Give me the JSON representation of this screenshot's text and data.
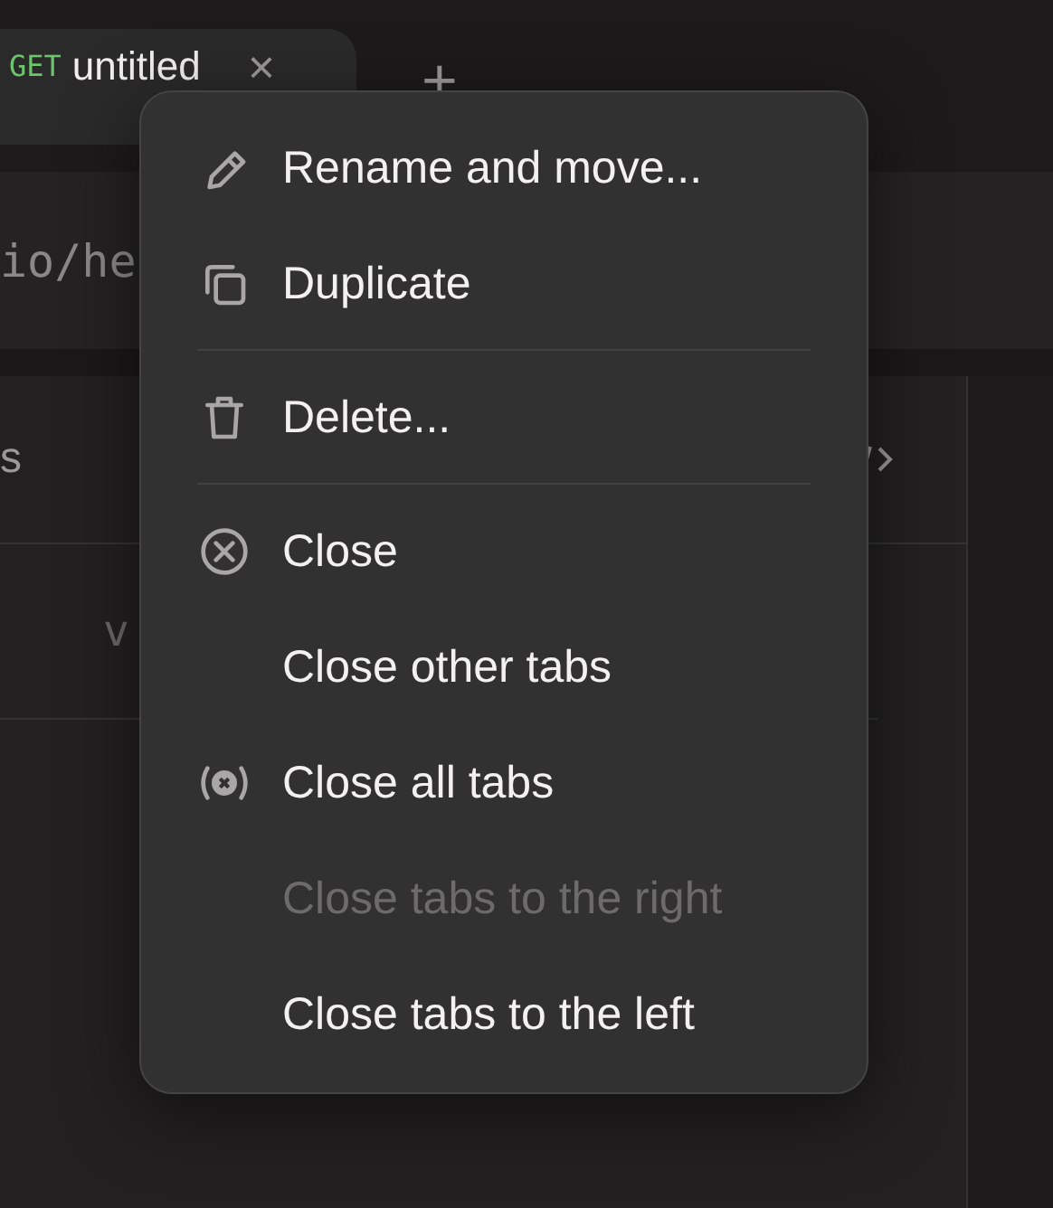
{
  "tab": {
    "method": "GET",
    "title": "untitled",
    "close": "×"
  },
  "new_tab": "+",
  "url_fragment": "io/he",
  "panel_tab_fragment": "s",
  "row_placeholder_fragment": "v",
  "context_menu": {
    "sections": [
      [
        {
          "label": "Rename and move...",
          "disabled": false
        },
        {
          "label": "Duplicate",
          "disabled": false
        }
      ],
      [
        {
          "label": "Delete...",
          "disabled": false
        }
      ],
      [
        {
          "label": "Close",
          "disabled": false
        },
        {
          "label": "Close other tabs",
          "disabled": false
        },
        {
          "label": "Close all tabs",
          "disabled": false
        },
        {
          "label": "Close tabs to the right",
          "disabled": true
        },
        {
          "label": "Close tabs to the left",
          "disabled": false
        }
      ]
    ]
  }
}
